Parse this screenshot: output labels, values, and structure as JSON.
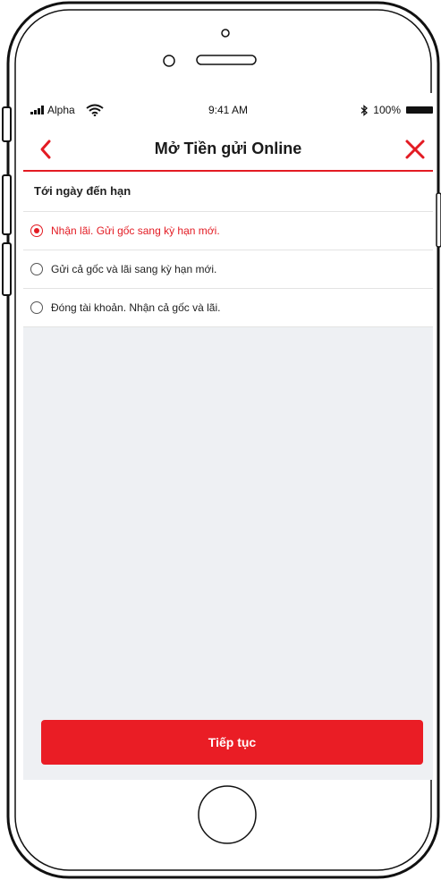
{
  "status_bar": {
    "carrier": "Alpha",
    "time": "9:41 AM",
    "battery": "100%"
  },
  "nav": {
    "title": "Mở Tiền gửi Online"
  },
  "section": {
    "title": "Tới ngày đến hạn"
  },
  "options": [
    {
      "label": "Nhận lãi. Gửi gốc sang kỳ hạn mới.",
      "selected": true
    },
    {
      "label": "Gửi cả gốc và lãi sang kỳ hạn mới.",
      "selected": false
    },
    {
      "label": "Đóng tài khoản. Nhận cả gốc và lãi.",
      "selected": false
    }
  ],
  "actions": {
    "continue_label": "Tiếp tục"
  },
  "colors": {
    "accent": "#e31b23",
    "background": "#eef0f3"
  }
}
